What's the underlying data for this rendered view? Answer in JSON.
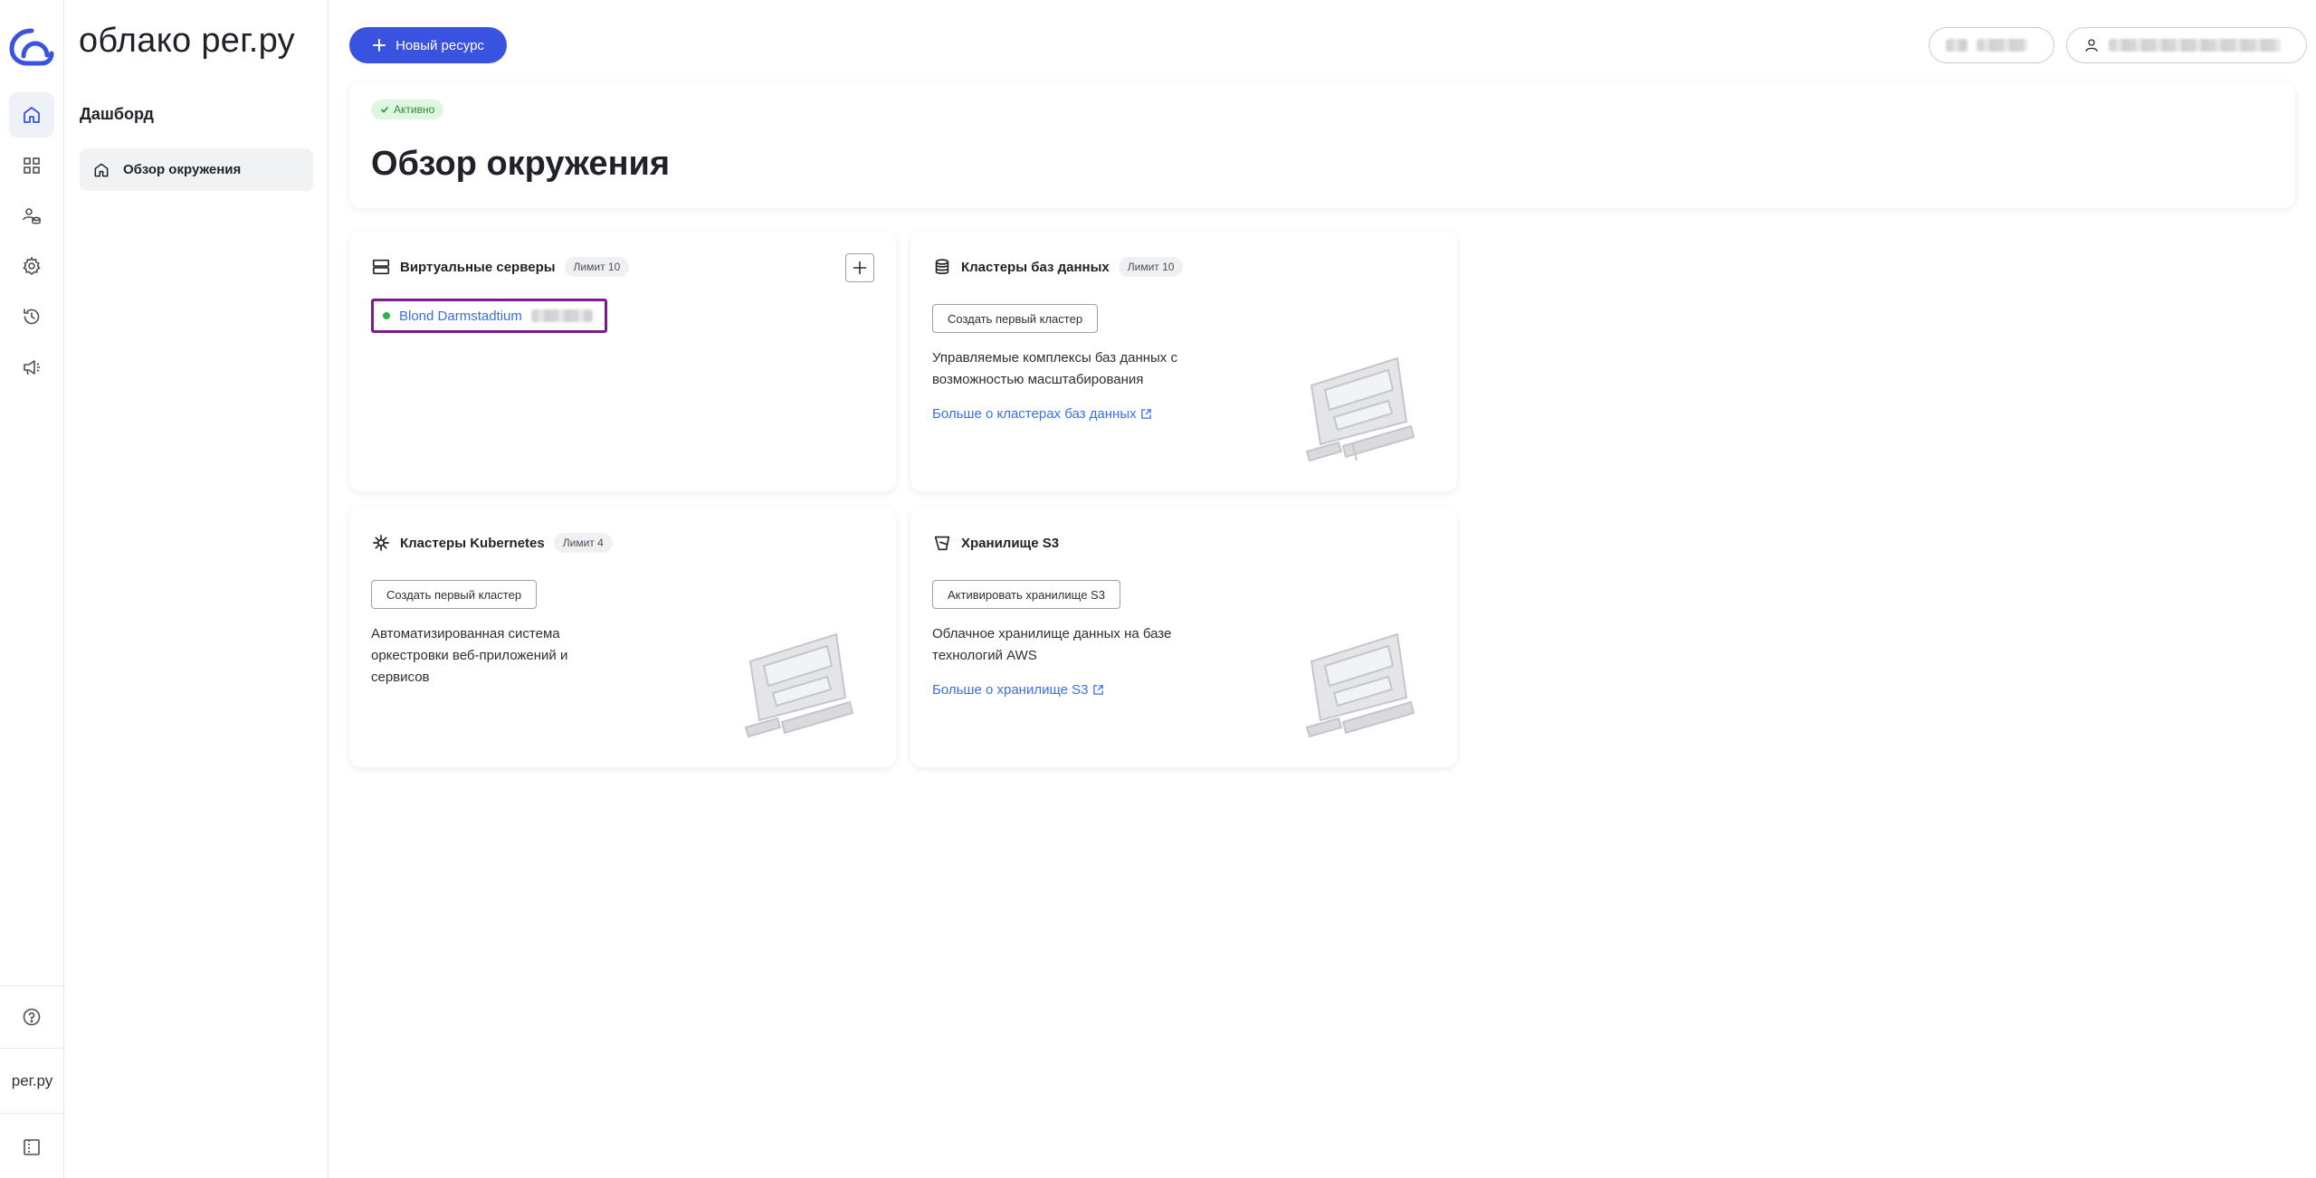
{
  "brand": "облако рег.ру",
  "rail": {
    "bottom_text": "рег.ру"
  },
  "sidebar": {
    "section_title": "Дашборд",
    "items": [
      {
        "label": "Обзор окружения",
        "icon": "home-icon",
        "active": true
      }
    ]
  },
  "topbar": {
    "new_resource_label": "Новый ресурс"
  },
  "header": {
    "status_badge": "Активно",
    "title": "Обзор окружения"
  },
  "cards": {
    "vms": {
      "title": "Виртуальные серверы",
      "limit": "Лимит 10",
      "servers": [
        {
          "name": "Blond Darmstadtium",
          "status_color": "#2fb24a"
        }
      ]
    },
    "db": {
      "title": "Кластеры баз данных",
      "limit": "Лимит 10",
      "button": "Создать первый кластер",
      "description": "Управляемые комплексы баз данных с возможностью масштабирования",
      "link": "Больше о кластерах баз данных"
    },
    "k8s": {
      "title": "Кластеры Kubernetes",
      "limit": "Лимит 4",
      "button": "Создать первый кластер",
      "description": "Автоматизированная система оркестровки веб-приложений и сервисов"
    },
    "s3": {
      "title": "Хранилище S3",
      "button": "Активировать хранилище S3",
      "description": "Облачное хранилище данных на базе технологий AWS",
      "link": "Больше о хранилище S3"
    }
  },
  "colors": {
    "accent": "#3a52e0",
    "link": "#3a6df0",
    "active_badge_bg": "#dff6df",
    "active_badge_text": "#2f8a3a",
    "highlight_border": "#7a1d8a"
  }
}
